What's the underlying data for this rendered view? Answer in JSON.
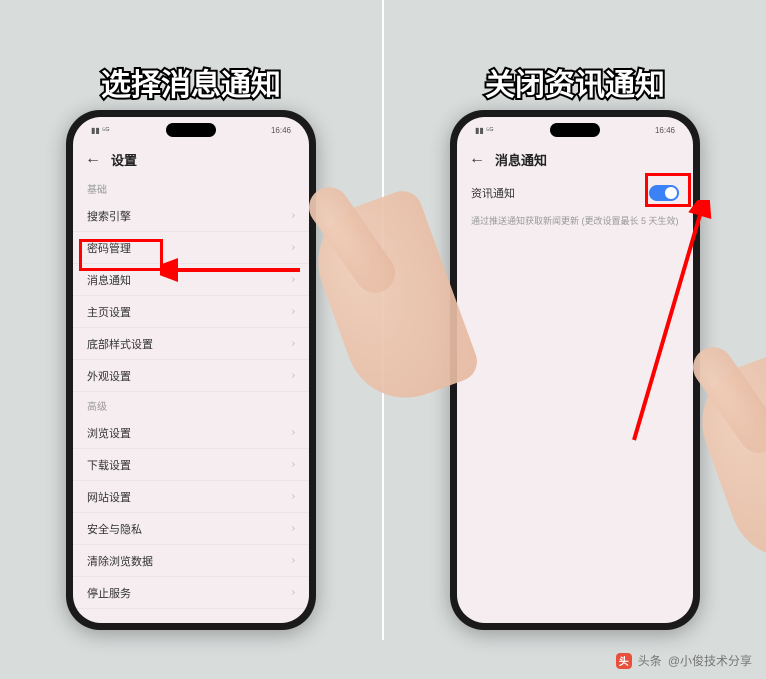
{
  "left": {
    "banner": "选择消息通知",
    "status_time": "16:46",
    "header_title": "设置",
    "section_basic": "基础",
    "items_basic": [
      "搜索引擎",
      "密码管理",
      "消息通知",
      "主页设置",
      "底部样式设置",
      "外观设置"
    ],
    "section_advanced": "高级",
    "items_advanced": [
      "浏览设置",
      "下载设置",
      "网站设置",
      "安全与隐私",
      "清除浏览数据",
      "停止服务"
    ]
  },
  "right": {
    "banner": "关闭资讯通知",
    "status_time": "16:46",
    "header_title": "消息通知",
    "toggle_label": "资讯通知",
    "hint": "通过推送通知获取新闻更新 (更改设置最长 5 天生效)"
  },
  "footer": {
    "prefix": "头条",
    "author": "@小俊技术分享"
  }
}
